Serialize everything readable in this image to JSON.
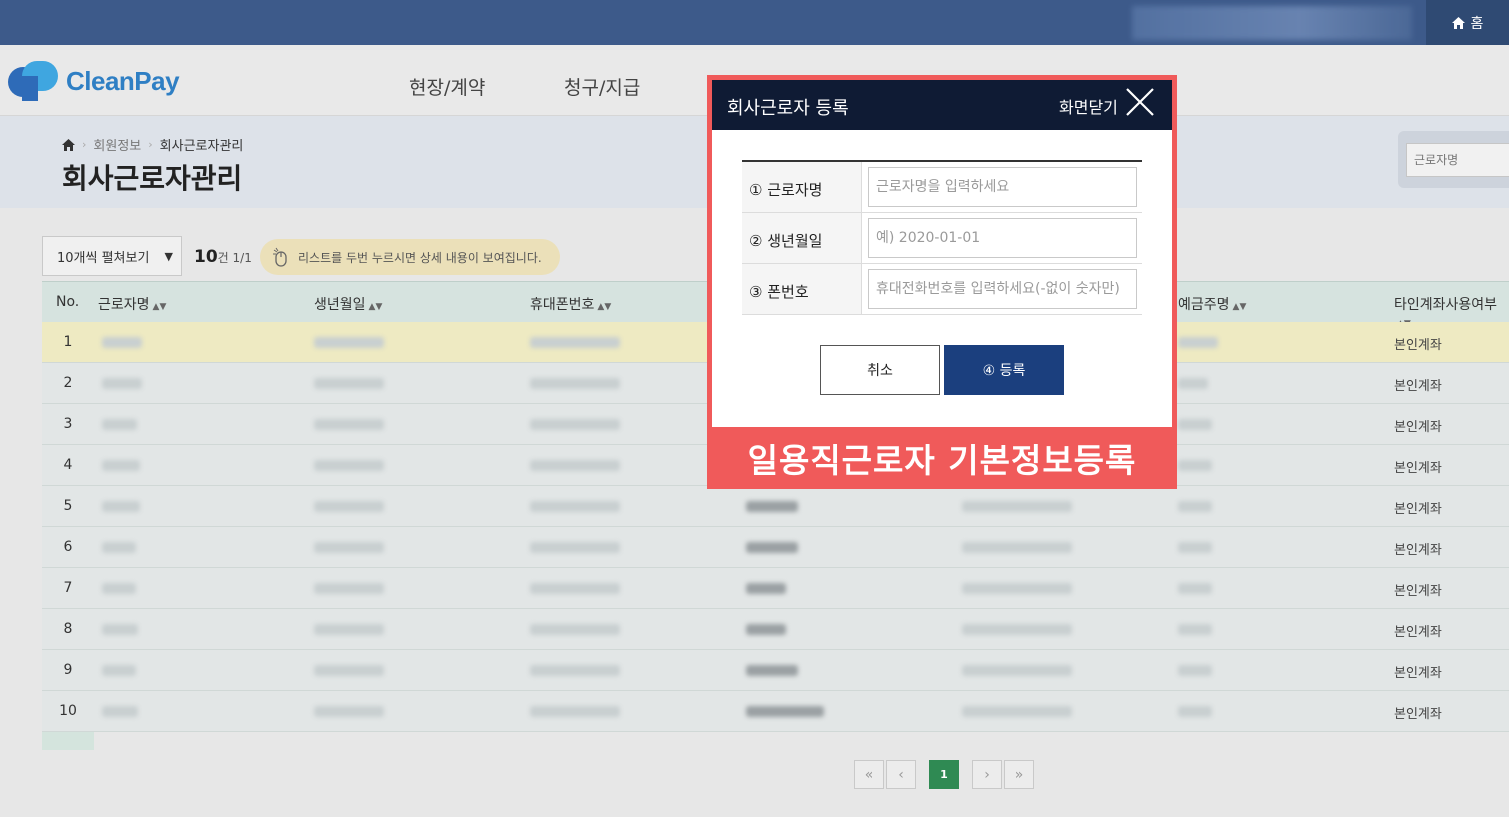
{
  "topbar": {
    "home_label": "홈"
  },
  "brand": {
    "name": "CleanPay"
  },
  "nav": {
    "items": [
      "현장/계약",
      "청구/지급"
    ]
  },
  "breadcrumb": {
    "parent": "회원정보",
    "current": "회사근로자관리"
  },
  "page_title": "회사근로자관리",
  "search": {
    "placeholder": "근로자명"
  },
  "toolbar": {
    "page_size_label": "10개씩 펼쳐보기",
    "count_value": "10",
    "count_suffix": "건 1/1",
    "hint": "리스트를 두번 누르시면 상세 내용이 보여집니다."
  },
  "table": {
    "columns": [
      "No.",
      "근로자명",
      "생년월일",
      "휴대폰번호",
      "예금주명",
      "타인계좌사용여부"
    ],
    "rows": [
      {
        "no": "1",
        "account_type": "본인계좌"
      },
      {
        "no": "2",
        "account_type": "본인계좌"
      },
      {
        "no": "3",
        "account_type": "본인계좌"
      },
      {
        "no": "4",
        "account_type": "본인계좌"
      },
      {
        "no": "5",
        "account_type": "본인계좌"
      },
      {
        "no": "6",
        "account_type": "본인계좌"
      },
      {
        "no": "7",
        "account_type": "본인계좌"
      },
      {
        "no": "8",
        "account_type": "본인계좌"
      },
      {
        "no": "9",
        "account_type": "본인계좌"
      },
      {
        "no": "10",
        "account_type": "본인계좌"
      }
    ],
    "selected_row": 1
  },
  "pagination": {
    "current": "1"
  },
  "modal": {
    "title": "회사근로자 등록",
    "close_label": "화면닫기",
    "fields": [
      {
        "label": "① 근로자명",
        "placeholder": "근로자명을 입력하세요"
      },
      {
        "label": "② 생년월일",
        "placeholder": "예) 2020-01-01"
      },
      {
        "label": "③ 폰번호",
        "placeholder": "휴대전화번호를 입력하세요(-없이 숫자만)"
      }
    ],
    "cancel_label": "취소",
    "register_label": "④ 등록"
  },
  "caption": "일용직근로자 기본정보등록",
  "colors": {
    "topbar": "#3d5a8a",
    "modal_header": "#0f1b34",
    "highlight_frame": "#f05a5a",
    "register_button": "#1b3f7e",
    "active_page": "#2f8a53"
  }
}
